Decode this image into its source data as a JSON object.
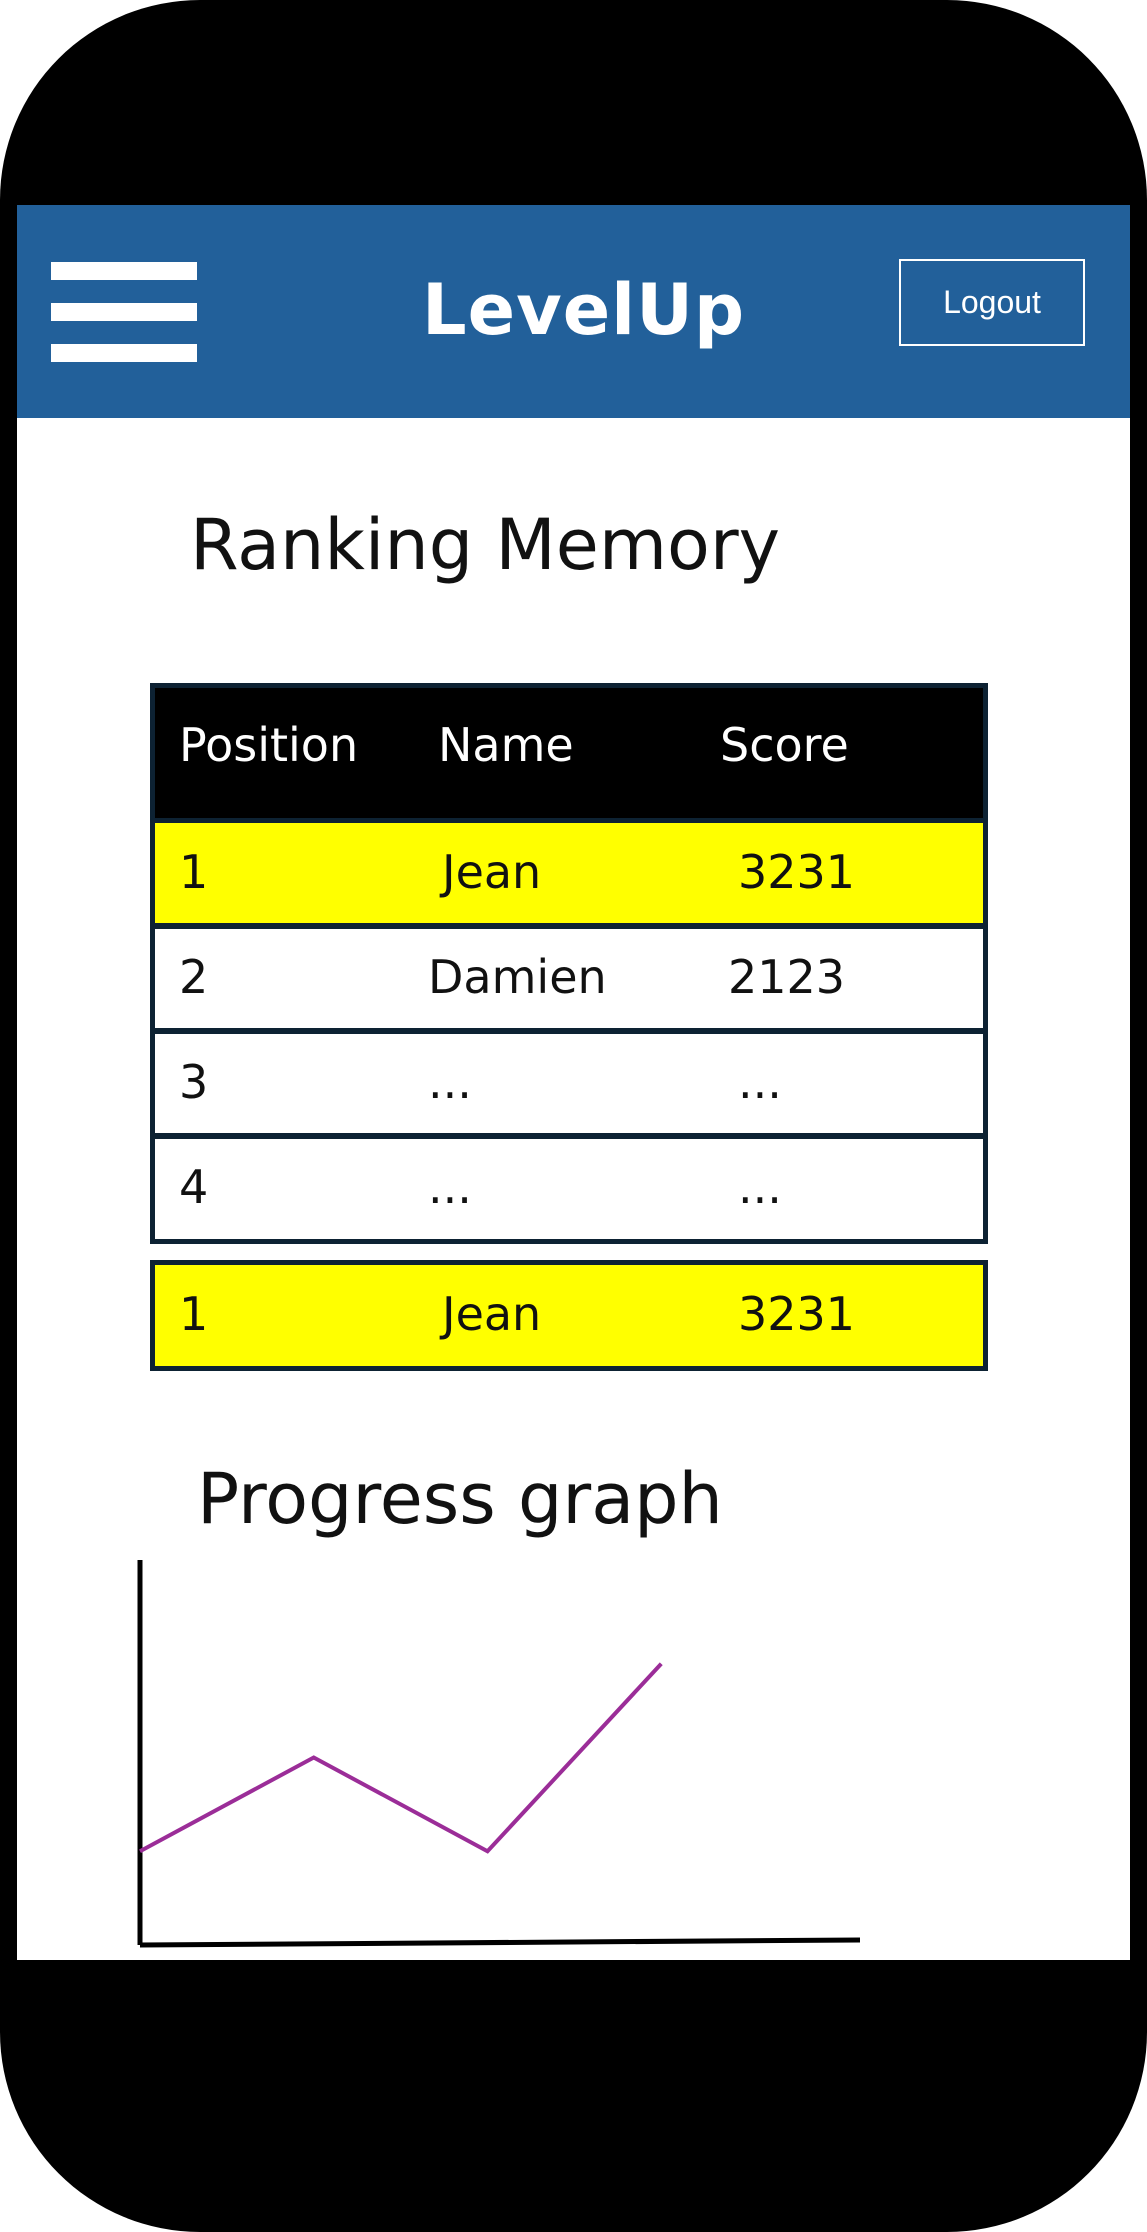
{
  "app": {
    "logo_text": "LevelUp",
    "logout_label": "Logout",
    "header_color": "#22609a"
  },
  "ranking": {
    "title": "Ranking Memory",
    "columns": [
      "Position",
      "Name",
      "Score"
    ],
    "rows": [
      {
        "position": "1",
        "name": "Jean",
        "score": "3231",
        "highlight": true
      },
      {
        "position": "2",
        "name": "Damien",
        "score": "2123",
        "highlight": false
      },
      {
        "position": "3",
        "name": "...",
        "score": "...",
        "highlight": false
      },
      {
        "position": "4",
        "name": "...",
        "score": "...",
        "highlight": false
      }
    ],
    "current_user": {
      "position": "1",
      "name": "Jean",
      "score": "3231"
    },
    "highlight_color": "#ffff00"
  },
  "progress": {
    "title": "Progress graph"
  },
  "chart_data": {
    "type": "line",
    "x": [
      0,
      1,
      2,
      3
    ],
    "series": [
      {
        "values": [
          1,
          2,
          1,
          3
        ],
        "color": "#9b2d98"
      }
    ],
    "xlim": [
      0,
      4
    ],
    "ylim": [
      0,
      4
    ],
    "grid": false,
    "title": "",
    "xlabel": "",
    "ylabel": ""
  },
  "icons": {
    "menu": "hamburger-menu-icon"
  }
}
